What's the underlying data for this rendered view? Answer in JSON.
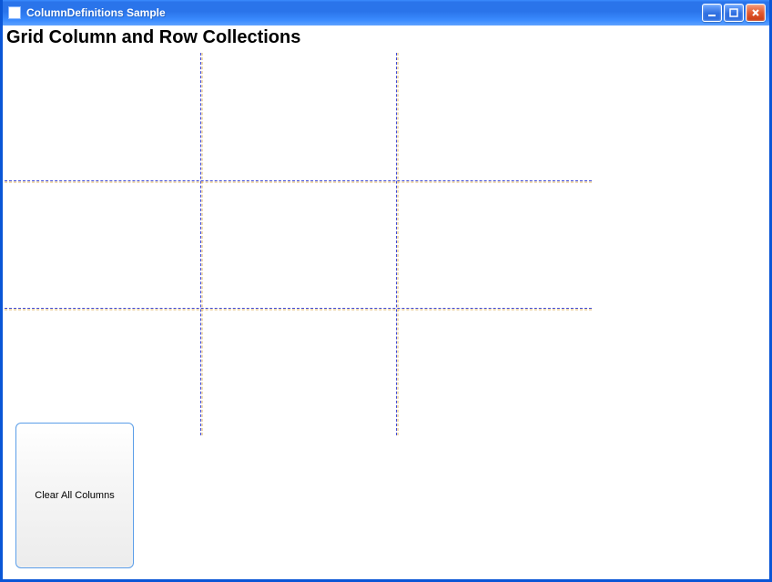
{
  "window": {
    "title": "ColumnDefinitions Sample"
  },
  "heading": "Grid Column and Row Collections",
  "buttons": {
    "clear_all_columns": "Clear All Columns"
  },
  "icons": {
    "app": "app-icon",
    "minimize": "minimize-icon",
    "maximize": "maximize-icon",
    "close": "close-icon"
  }
}
